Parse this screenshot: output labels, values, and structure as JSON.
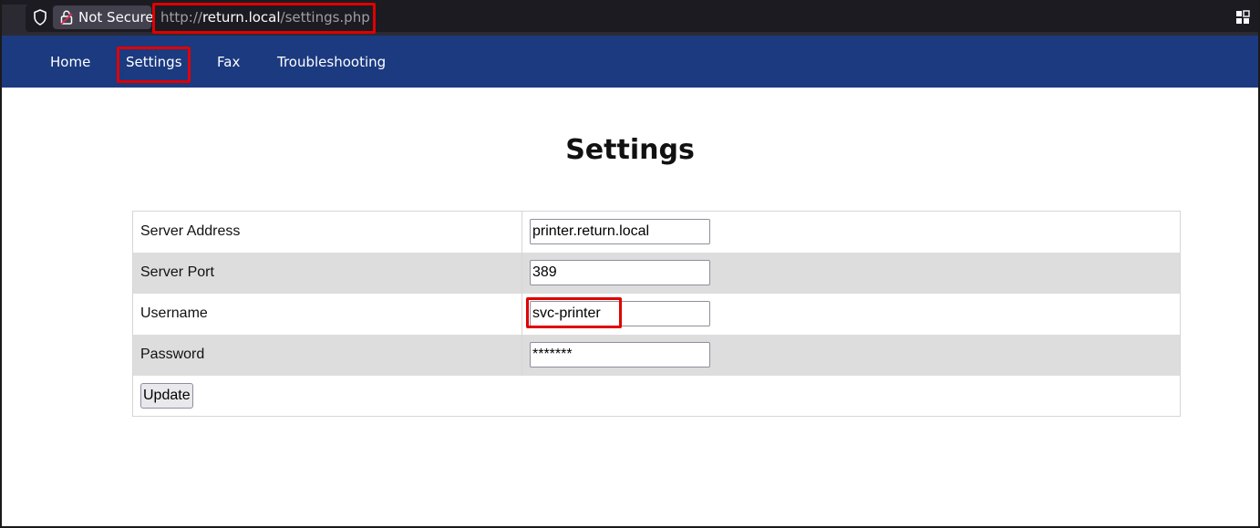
{
  "browser": {
    "security_label": "Not Secure",
    "url_scheme": "http://",
    "url_host": "return.local",
    "url_path": "/settings.php"
  },
  "nav": {
    "items": [
      {
        "label": "Home"
      },
      {
        "label": "Settings"
      },
      {
        "label": "Fax"
      },
      {
        "label": "Troubleshooting"
      }
    ]
  },
  "page": {
    "title": "Settings"
  },
  "form": {
    "rows": [
      {
        "label": "Server Address",
        "value": "printer.return.local"
      },
      {
        "label": "Server Port",
        "value": "389"
      },
      {
        "label": "Username",
        "value": "svc-printer"
      },
      {
        "label": "Password",
        "value": "*******"
      }
    ],
    "submit_label": "Update"
  },
  "colors": {
    "nav_background": "#1b3a80",
    "highlight": "#e00000",
    "row_alt": "#dddddd"
  }
}
